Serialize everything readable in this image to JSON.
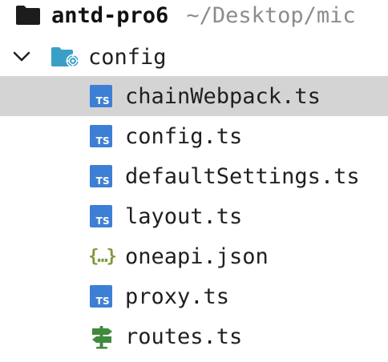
{
  "project": {
    "name": "antd-pro6",
    "path": "~/Desktop/mic",
    "icon": "folder-icon"
  },
  "folder": {
    "name": "config",
    "expanded": true,
    "icon": "config-folder-icon"
  },
  "files": [
    {
      "name": "chainWebpack.ts",
      "icon": "typescript-file-icon",
      "icon_text": "TS",
      "selected": true
    },
    {
      "name": "config.ts",
      "icon": "typescript-file-icon",
      "icon_text": "TS",
      "selected": false
    },
    {
      "name": "defaultSettings.ts",
      "icon": "typescript-file-icon",
      "icon_text": "TS",
      "selected": false
    },
    {
      "name": "layout.ts",
      "icon": "typescript-file-icon",
      "icon_text": "TS",
      "selected": false
    },
    {
      "name": "oneapi.json",
      "icon": "json-file-icon",
      "icon_text": "{…}",
      "selected": false
    },
    {
      "name": "proxy.ts",
      "icon": "typescript-file-icon",
      "icon_text": "TS",
      "selected": false
    },
    {
      "name": "routes.ts",
      "icon": "routes-signpost-icon",
      "icon_text": "",
      "selected": false
    }
  ],
  "colors": {
    "typescript": "#3d7fd4",
    "json": "#7f9a3c",
    "routes": "#3f8a3c",
    "folder_teal": "#3a9fc7",
    "selection": "#d4d4d4",
    "path_text": "#8c8c8c"
  }
}
